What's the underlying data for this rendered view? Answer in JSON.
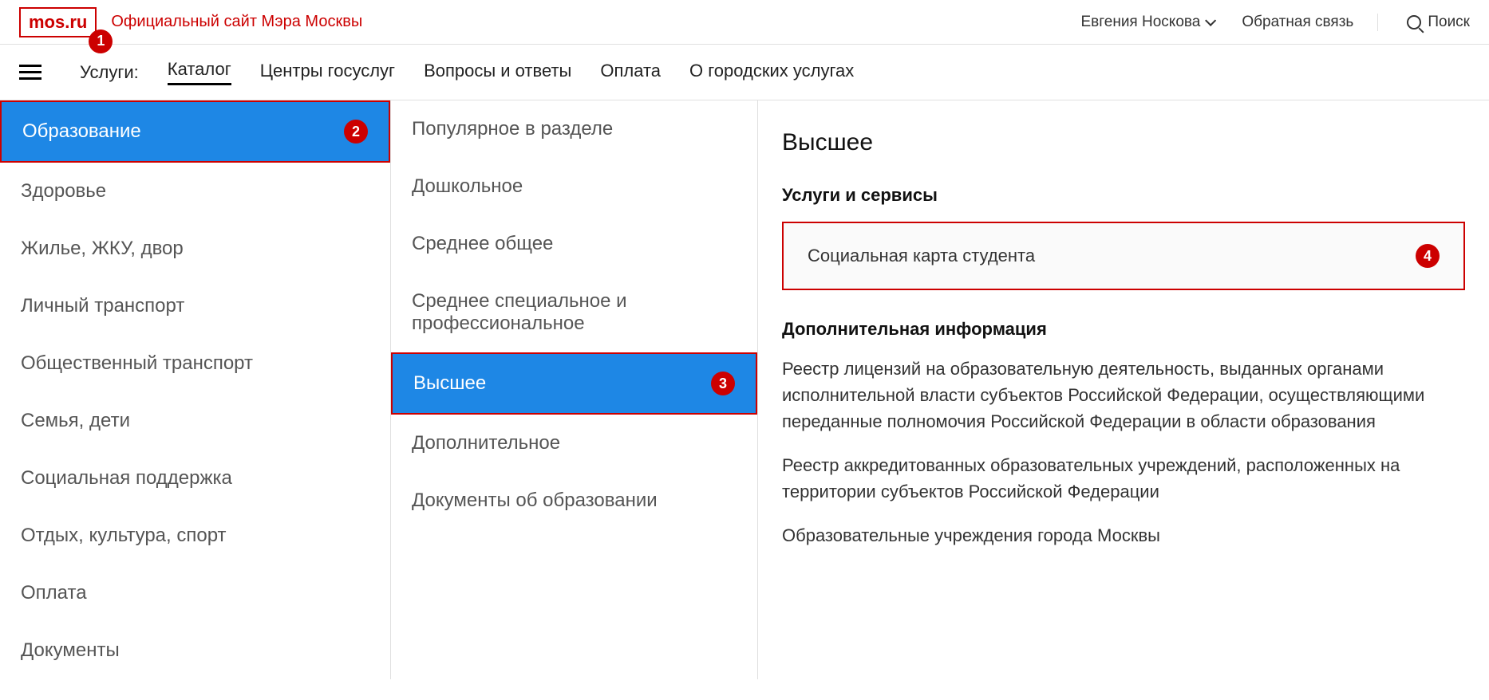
{
  "header": {
    "logo": "mos.ru",
    "slogan": "Официальный сайт Мэра Москвы",
    "user_name": "Евгения Носкова",
    "feedback": "Обратная связь",
    "search_label": "Поиск"
  },
  "nav": {
    "label": "Услуги:",
    "items": [
      "Каталог",
      "Центры госуслуг",
      "Вопросы и ответы",
      "Оплата",
      "О городских услугах"
    ],
    "active_index": 0
  },
  "col1": {
    "items": [
      "Образование",
      "Здоровье",
      "Жилье, ЖКУ, двор",
      "Личный транспорт",
      "Общественный транспорт",
      "Семья, дети",
      "Социальная поддержка",
      "Отдых, культура, спорт",
      "Оплата",
      "Документы"
    ],
    "selected_index": 0
  },
  "col2": {
    "items": [
      "Популярное в разделе",
      "Дошкольное",
      "Среднее общее",
      "Среднее специальное и профессиональное",
      "Высшее",
      "Дополнительное",
      "Документы об образовании"
    ],
    "selected_index": 4
  },
  "detail": {
    "title": "Высшее",
    "sub1": "Услуги и сервисы",
    "service": "Социальная карта студента",
    "sub2": "Дополнительная информация",
    "paras": [
      "Реестр лицензий на образовательную деятельность, выданных органами исполнительной власти субъектов Российской Федерации, осуществляющими переданные полномочия Российской Федерации в области образования",
      "Реестр аккредитованных образовательных учреждений, расположенных на территории субъектов Российской Федерации",
      "Образовательные учреждения города Москвы"
    ]
  },
  "badges": {
    "b1": "1",
    "b2": "2",
    "b3": "3",
    "b4": "4"
  }
}
